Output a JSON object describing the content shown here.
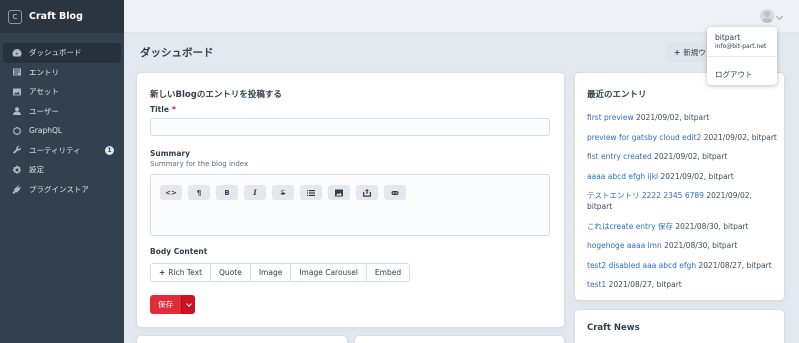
{
  "brand": {
    "logo_letter": "C",
    "name": "Craft Blog"
  },
  "sidebar": {
    "items": [
      {
        "label": "ダッシュボード",
        "icon": "dashboard-icon",
        "active": true
      },
      {
        "label": "エントリ",
        "icon": "entries-icon"
      },
      {
        "label": "アセット",
        "icon": "assets-icon"
      },
      {
        "label": "ユーザー",
        "icon": "users-icon"
      },
      {
        "label": "GraphQL",
        "icon": "graphql-icon"
      },
      {
        "label": "ユーティリティ",
        "icon": "wrench-icon",
        "badge": "1"
      },
      {
        "label": "設定",
        "icon": "gear-icon"
      },
      {
        "label": "プラグインストア",
        "icon": "plug-icon"
      }
    ]
  },
  "header": {
    "page_title": "ダッシュボード",
    "new_widget_label": "新規ウ"
  },
  "user_menu": {
    "username": "bitpart",
    "email": "info@bit-part.net",
    "logout_label": "ログアウト"
  },
  "quick_post": {
    "title": "新しいBlogのエントリを投稿する",
    "title_field_label": "Title",
    "required_marker": "*",
    "summary_label": "Summary",
    "summary_hint": "Summary for the blog index",
    "toolbar": [
      {
        "name": "code-icon",
        "glyph": "<>"
      },
      {
        "name": "paragraph-icon",
        "glyph": "¶"
      },
      {
        "name": "bold-icon",
        "glyph": "B"
      },
      {
        "name": "italic-icon",
        "glyph": "I"
      },
      {
        "name": "strikethrough-icon",
        "glyph": "S"
      },
      {
        "name": "list-icon",
        "glyph": ""
      },
      {
        "name": "image-icon",
        "glyph": ""
      },
      {
        "name": "embed-icon",
        "glyph": ""
      },
      {
        "name": "link-icon",
        "glyph": ""
      }
    ],
    "body_label": "Body Content",
    "matrix_buttons": [
      "Rich Text",
      "Quote",
      "Image",
      "Image Carousel",
      "Embed"
    ],
    "add_symbol": "+",
    "save_label": "保存"
  },
  "recent_entries": {
    "title": "最近のエントリ",
    "items": [
      {
        "title": "first preview",
        "meta": "2021/09/02, bitpart"
      },
      {
        "title": "preview for gatsby cloud edit2",
        "meta": "2021/09/02, bitpart"
      },
      {
        "title": "fist entry created",
        "meta": "2021/09/02, bitpart"
      },
      {
        "title": "aaaa abcd efgh ijkl",
        "meta": "2021/09/02, bitpart"
      },
      {
        "title": "テストエントリ 2222 2345 6789",
        "meta": "2021/09/02, bitpart"
      },
      {
        "title": "これはcreate entry 保存",
        "meta": "2021/08/30, bitpart"
      },
      {
        "title": "hogehoge aaaa lmn",
        "meta": "2021/08/30, bitpart"
      },
      {
        "title": "test2 disabled aaa abcd efgh",
        "meta": "2021/08/27, bitpart"
      },
      {
        "title": "test1",
        "meta": "2021/08/27, bitpart"
      }
    ]
  },
  "craft_news": {
    "title": "Craft News"
  },
  "colors": {
    "sidebar": "#33404d",
    "accent_red": "#e12d39",
    "link": "#2e6fbe"
  }
}
